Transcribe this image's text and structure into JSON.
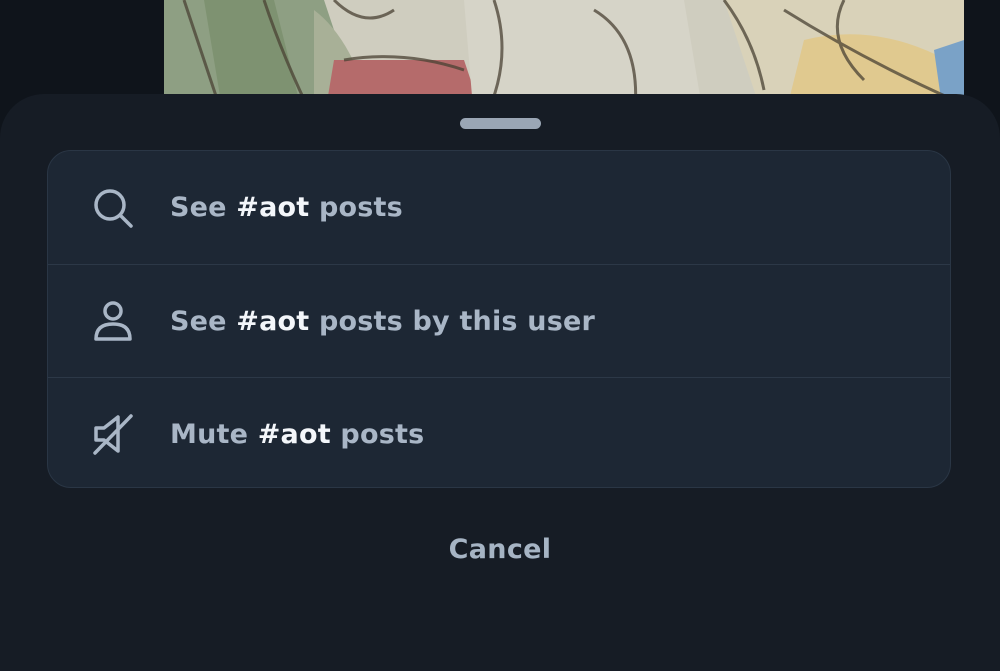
{
  "menu": {
    "items": [
      {
        "prefix": "See ",
        "tag": "#aot",
        "suffix": " posts",
        "icon": "search-icon"
      },
      {
        "prefix": "See ",
        "tag": "#aot",
        "suffix": " posts by this user",
        "icon": "person-icon"
      },
      {
        "prefix": "Mute ",
        "tag": "#aot",
        "suffix": " posts",
        "icon": "speaker-muted-icon"
      }
    ]
  },
  "cancel_label": "Cancel",
  "colors": {
    "background": "#0f141b",
    "sheet": "#161c25",
    "menu_surface": "#1d2734",
    "label_text": "#a9b6c6",
    "tag_text": "#f3f6fa"
  }
}
